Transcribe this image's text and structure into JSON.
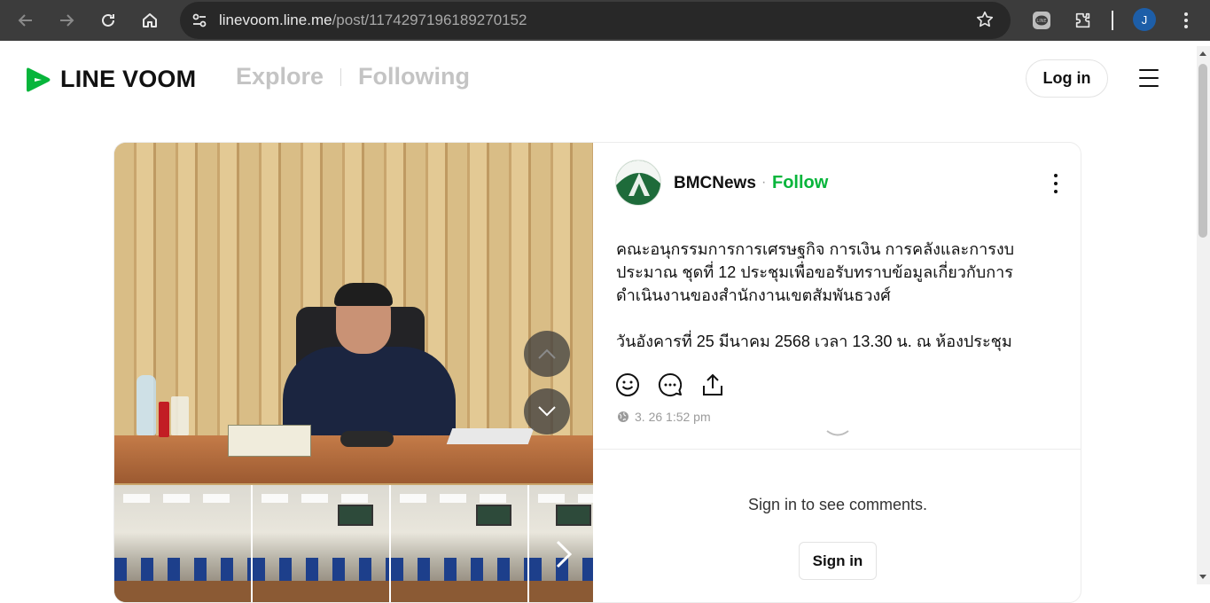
{
  "browser": {
    "url_domain": "linevoom.line.me",
    "url_path": "/post/1174297196189270152",
    "profile_initial": "J"
  },
  "header": {
    "logo_text": "LINE VOOM",
    "tabs": [
      {
        "label": "Explore",
        "active": false
      },
      {
        "label": "Following",
        "active": false
      }
    ],
    "login_label": "Log in"
  },
  "post": {
    "author": "BMCNews",
    "separator": "·",
    "follow_label": "Follow",
    "text_lines": [
      "คณะอนุกรรมการการเศรษฐกิจ การเงิน การคลังและการงบ",
      "ประมาณ ชุดที่ 12 ประชุมเพื่อขอรับทราบข้อมูลเกี่ยวกับการ",
      "ดำเนินงานของสำนักงานเขตสัมพันธวงศ์"
    ],
    "text_line_date": "วันอังคารที่ 25 มีนาคม 2568 เวลา 13.30 น. ณ ห้องประชุม",
    "timestamp": "3. 26 1:52 pm"
  },
  "comments": {
    "prompt": "Sign in to see comments.",
    "signin_label": "Sign in"
  },
  "colors": {
    "brand_green": "#07b53b",
    "chrome_bg": "#3c3c3c",
    "omnibox_bg": "#282828"
  }
}
